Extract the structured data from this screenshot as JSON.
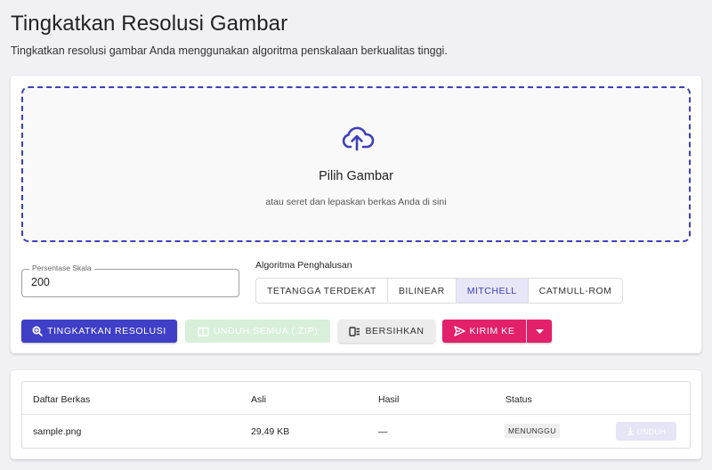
{
  "header": {
    "title": "Tingkatkan Resolusi Gambar",
    "subtitle": "Tingkatkan resolusi gambar Anda menggunakan algoritma penskalaan berkualitas tinggi."
  },
  "dropzone": {
    "icon": "cloud-upload-icon",
    "title": "Pilih Gambar",
    "subtitle": "atau seret dan lepaskan berkas Anda di sini"
  },
  "scale": {
    "label": "Persentase Skala",
    "value": "200"
  },
  "algorithm": {
    "label": "Algoritma Penghalusan",
    "options": [
      "TETANGGA TERDEKAT",
      "BILINEAR",
      "MITCHELL",
      "CATMULL-ROM"
    ],
    "selected": "MITCHELL"
  },
  "actions": {
    "upscale_label": "TINGKATKAN RESOLUSI",
    "download_all_label": "UNDUH SEMUA (.ZIP)",
    "clear_label": "BERSIHKAN",
    "send_label": "KIRIM KE"
  },
  "files_table": {
    "headers": [
      "Daftar Berkas",
      "Asli",
      "Hasil",
      "Status"
    ],
    "rows": [
      {
        "name": "sample.png",
        "original": "29,49 KB",
        "result": "—",
        "status": "MENUNGGU",
        "download_label": "UNDUH"
      }
    ]
  },
  "colors": {
    "primary": "#3f3fc7",
    "accent": "#e3206a",
    "dropzone_border": "#3f3fb8",
    "selected_algo_bg": "#e8e6f9",
    "disabled_green": "#d8f0d9"
  }
}
